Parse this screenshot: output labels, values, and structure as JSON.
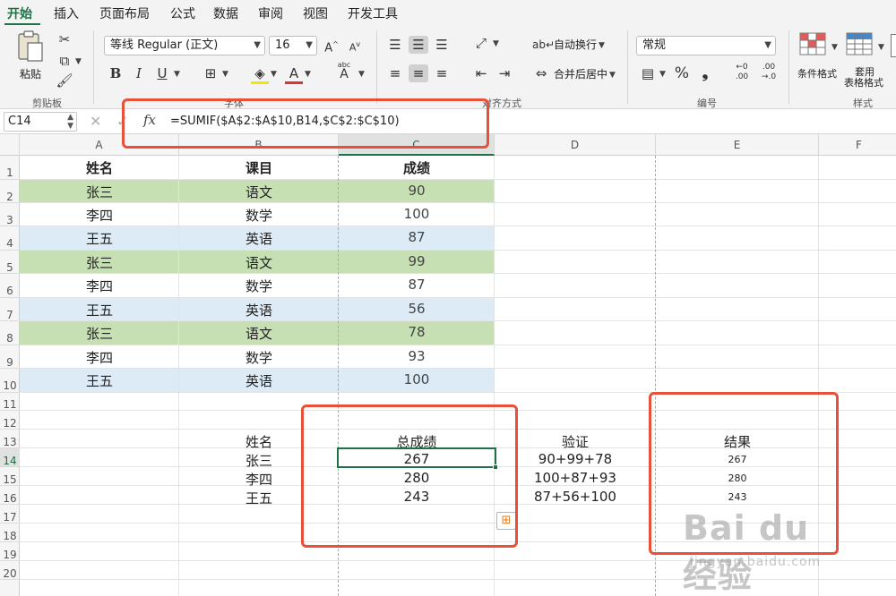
{
  "ribbon_tabs": [
    "开始",
    "插入",
    "页面布局",
    "公式",
    "数据",
    "审阅",
    "视图",
    "开发工具"
  ],
  "ribbon": {
    "paste_label": "粘贴",
    "clipboard_label": "剪贴板",
    "font_name": "等线 Regular (正文)",
    "font_size": "16",
    "font_label": "字体",
    "bold": "B",
    "italic": "I",
    "underline": "U",
    "font_color_glyph": "A",
    "phonetic_glyph": "abc",
    "wrap_text": "自动换行",
    "merge_center": "合并后居中",
    "alignment_label": "对齐方式",
    "number_format": "常规",
    "percent": "%",
    "comma": "❟",
    "number_label": "编号",
    "conditional_format": "条件格式",
    "table_format_line1": "套用",
    "table_format_line2": "表格格式",
    "styles_label": "样式",
    "dec_inc_glyph": ".00",
    "dec_dec_glyph": ".0"
  },
  "formula_bar": {
    "name_box": "C14",
    "fx": "fx",
    "formula": "=SUMIF($A$2:$A$10,B14,$C$2:$C$10)"
  },
  "columns": [
    "A",
    "B",
    "C",
    "D",
    "E",
    "F"
  ],
  "rows": [
    "1",
    "2",
    "3",
    "4",
    "5",
    "6",
    "7",
    "8",
    "9",
    "10",
    "11",
    "12",
    "13",
    "14",
    "15",
    "16",
    "17",
    "18",
    "19",
    "20"
  ],
  "table_header": [
    "姓名",
    "课目",
    "成绩"
  ],
  "table_rows": [
    {
      "name": "张三",
      "subject": "语文",
      "score": "90"
    },
    {
      "name": "李四",
      "subject": "数学",
      "score": "100"
    },
    {
      "name": "王五",
      "subject": "英语",
      "score": "87"
    },
    {
      "name": "张三",
      "subject": "语文",
      "score": "99"
    },
    {
      "name": "李四",
      "subject": "数学",
      "score": "87"
    },
    {
      "name": "王五",
      "subject": "英语",
      "score": "56"
    },
    {
      "name": "张三",
      "subject": "语文",
      "score": "78"
    },
    {
      "name": "李四",
      "subject": "数学",
      "score": "93"
    },
    {
      "name": "王五",
      "subject": "英语",
      "score": "100"
    }
  ],
  "summary_header": {
    "name": "姓名",
    "total": "总成绩",
    "verify": "验证",
    "result": "结果"
  },
  "summary_rows": [
    {
      "name": "张三",
      "total": "267",
      "verify": "90+99+78",
      "result": "267"
    },
    {
      "name": "李四",
      "total": "280",
      "verify": "100+87+93",
      "result": "280"
    },
    {
      "name": "王五",
      "total": "243",
      "verify": "87+56+100",
      "result": "243"
    }
  ],
  "colors": {
    "accent": "#1e7145",
    "band_green": "#c6e0b4",
    "band_blue": "#ddebf7",
    "annotation_red": "#e8503a"
  },
  "watermark": {
    "main": "Bai du 经验",
    "sub": "jingyan.baidu.com"
  }
}
